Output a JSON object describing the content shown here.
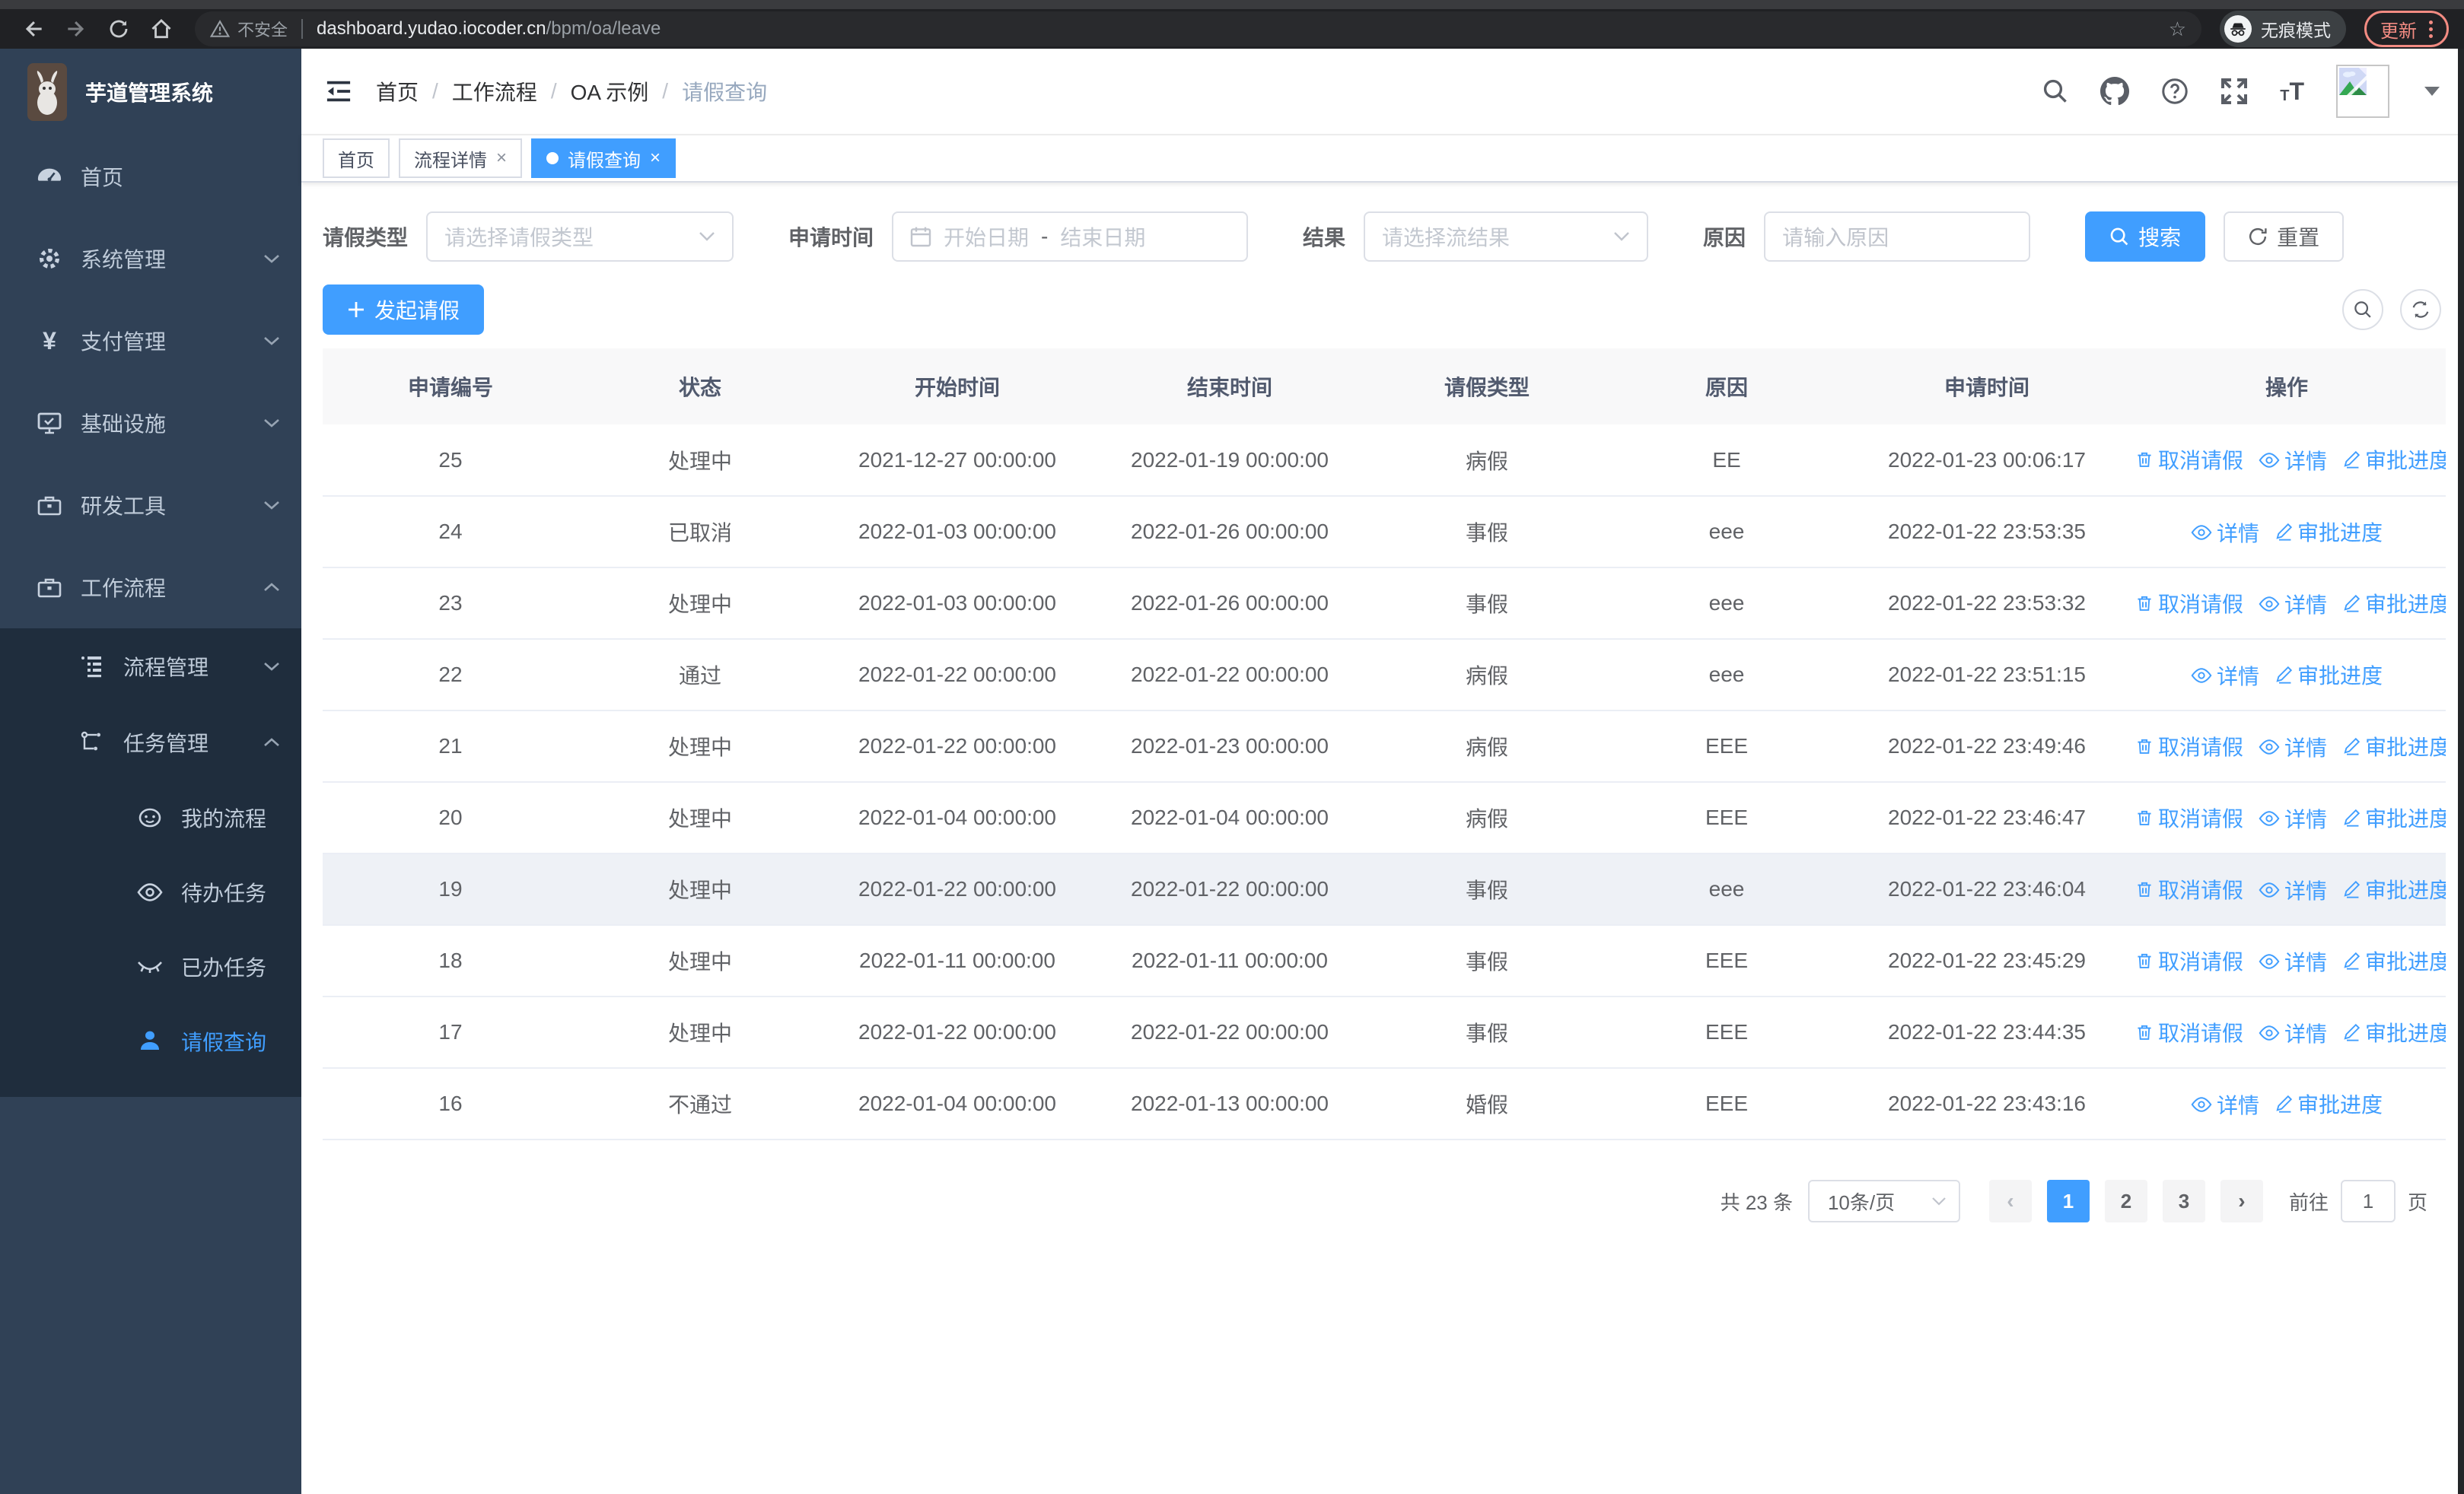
{
  "colors": {
    "accent": "#409eff",
    "sidebar_bg": "#304156",
    "submenu_bg": "#1f2d3d",
    "sidebar_text": "#bfcbd9",
    "table_header_bg": "#f8f8f9",
    "update_red": "#f28b82"
  },
  "browser": {
    "security_label": "不安全",
    "url_host": "dashboard.yudao.iocoder.cn",
    "url_path": "/bpm/oa/leave",
    "incognito_label": "无痕模式",
    "update_label": "更新"
  },
  "sidebar": {
    "logo_title": "芋道管理系统",
    "items": [
      {
        "label": "首页"
      },
      {
        "label": "系统管理"
      },
      {
        "label": "支付管理"
      },
      {
        "label": "基础设施"
      },
      {
        "label": "研发工具"
      },
      {
        "label": "工作流程"
      },
      {
        "label": "流程管理"
      },
      {
        "label": "任务管理"
      },
      {
        "label": "我的流程"
      },
      {
        "label": "待办任务"
      },
      {
        "label": "已办任务"
      },
      {
        "label": "请假查询"
      }
    ]
  },
  "header": {
    "breadcrumb": [
      "首页",
      "工作流程",
      "OA 示例",
      "请假查询"
    ]
  },
  "tabs": [
    {
      "label": "首页"
    },
    {
      "label": "流程详情"
    },
    {
      "label": "请假查询"
    }
  ],
  "filters": {
    "type_label": "请假类型",
    "type_placeholder": "请选择请假类型",
    "time_label": "申请时间",
    "start_placeholder": "开始日期",
    "range_separator": "-",
    "end_placeholder": "结束日期",
    "result_label": "结果",
    "result_placeholder": "请选择流结果",
    "reason_label": "原因",
    "reason_placeholder": "请输入原因",
    "search_label": "搜索",
    "reset_label": "重置"
  },
  "toolbar": {
    "create_label": "发起请假"
  },
  "table": {
    "columns": [
      "申请编号",
      "状态",
      "开始时间",
      "结束时间",
      "请假类型",
      "原因",
      "申请时间",
      "操作"
    ],
    "action_labels": {
      "cancel": "取消请假",
      "detail": "详情",
      "progress": "审批进度"
    },
    "rows": [
      {
        "id": "25",
        "status": "处理中",
        "start": "2021-12-27 00:00:00",
        "end": "2022-01-19 00:00:00",
        "type": "病假",
        "reason": "EE",
        "apply_time": "2022-01-23 00:06:17",
        "actions": [
          "cancel",
          "detail",
          "progress"
        ],
        "highlighted": false
      },
      {
        "id": "24",
        "status": "已取消",
        "start": "2022-01-03 00:00:00",
        "end": "2022-01-26 00:00:00",
        "type": "事假",
        "reason": "eee",
        "apply_time": "2022-01-22 23:53:35",
        "actions": [
          "detail",
          "progress"
        ],
        "highlighted": false
      },
      {
        "id": "23",
        "status": "处理中",
        "start": "2022-01-03 00:00:00",
        "end": "2022-01-26 00:00:00",
        "type": "事假",
        "reason": "eee",
        "apply_time": "2022-01-22 23:53:32",
        "actions": [
          "cancel",
          "detail",
          "progress"
        ],
        "highlighted": false
      },
      {
        "id": "22",
        "status": "通过",
        "start": "2022-01-22 00:00:00",
        "end": "2022-01-22 00:00:00",
        "type": "病假",
        "reason": "eee",
        "apply_time": "2022-01-22 23:51:15",
        "actions": [
          "detail",
          "progress"
        ],
        "highlighted": false
      },
      {
        "id": "21",
        "status": "处理中",
        "start": "2022-01-22 00:00:00",
        "end": "2022-01-23 00:00:00",
        "type": "病假",
        "reason": "EEE",
        "apply_time": "2022-01-22 23:49:46",
        "actions": [
          "cancel",
          "detail",
          "progress"
        ],
        "highlighted": false
      },
      {
        "id": "20",
        "status": "处理中",
        "start": "2022-01-04 00:00:00",
        "end": "2022-01-04 00:00:00",
        "type": "病假",
        "reason": "EEE",
        "apply_time": "2022-01-22 23:46:47",
        "actions": [
          "cancel",
          "detail",
          "progress"
        ],
        "highlighted": false
      },
      {
        "id": "19",
        "status": "处理中",
        "start": "2022-01-22 00:00:00",
        "end": "2022-01-22 00:00:00",
        "type": "事假",
        "reason": "eee",
        "apply_time": "2022-01-22 23:46:04",
        "actions": [
          "cancel",
          "detail",
          "progress"
        ],
        "highlighted": true
      },
      {
        "id": "18",
        "status": "处理中",
        "start": "2022-01-11 00:00:00",
        "end": "2022-01-11 00:00:00",
        "type": "事假",
        "reason": "EEE",
        "apply_time": "2022-01-22 23:45:29",
        "actions": [
          "cancel",
          "detail",
          "progress"
        ],
        "highlighted": false
      },
      {
        "id": "17",
        "status": "处理中",
        "start": "2022-01-22 00:00:00",
        "end": "2022-01-22 00:00:00",
        "type": "事假",
        "reason": "EEE",
        "apply_time": "2022-01-22 23:44:35",
        "actions": [
          "cancel",
          "detail",
          "progress"
        ],
        "highlighted": false
      },
      {
        "id": "16",
        "status": "不通过",
        "start": "2022-01-04 00:00:00",
        "end": "2022-01-13 00:00:00",
        "type": "婚假",
        "reason": "EEE",
        "apply_time": "2022-01-22 23:43:16",
        "actions": [
          "detail",
          "progress"
        ],
        "highlighted": false
      }
    ]
  },
  "pagination": {
    "total_label": "共 23 条",
    "page_size": "10条/页",
    "pages": [
      "1",
      "2",
      "3"
    ],
    "active_page": "1",
    "goto_label": "前往",
    "goto_value": "1",
    "page_suffix": "页"
  }
}
